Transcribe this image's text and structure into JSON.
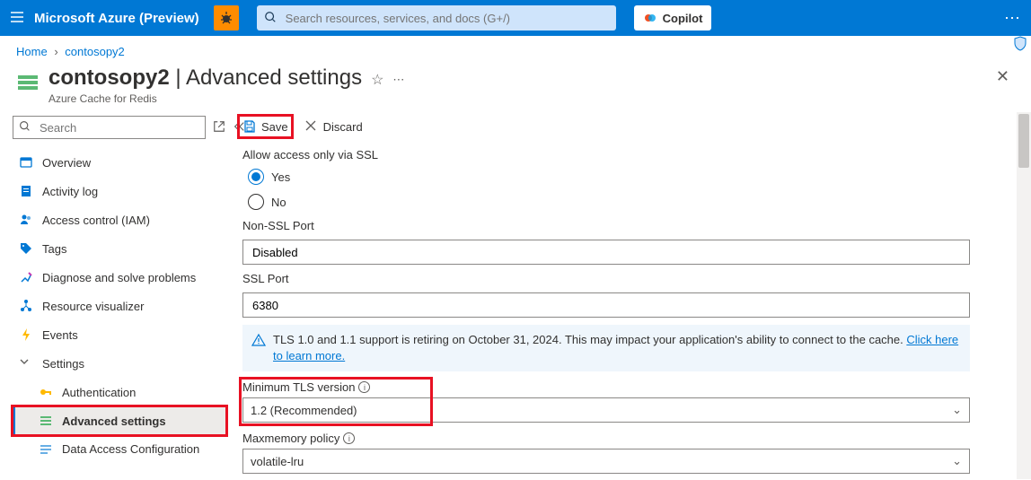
{
  "top": {
    "brand": "Microsoft Azure (Preview)",
    "search_placeholder": "Search resources, services, and docs (G+/)",
    "copilot": "Copilot"
  },
  "breadcrumb": {
    "home": "Home",
    "current": "contosopy2"
  },
  "header": {
    "resource": "contosopy2",
    "page": "Advanced settings",
    "subtype": "Azure Cache for Redis"
  },
  "sidebar": {
    "search_placeholder": "Search",
    "items": [
      {
        "label": "Overview"
      },
      {
        "label": "Activity log"
      },
      {
        "label": "Access control (IAM)"
      },
      {
        "label": "Tags"
      },
      {
        "label": "Diagnose and solve problems"
      },
      {
        "label": "Resource visualizer"
      },
      {
        "label": "Events"
      },
      {
        "label": "Settings",
        "group": true
      },
      {
        "label": "Authentication",
        "sub": true
      },
      {
        "label": "Advanced settings",
        "sub": true,
        "selected": true
      },
      {
        "label": "Data Access Configuration",
        "sub": true
      }
    ]
  },
  "toolbar": {
    "save": "Save",
    "discard": "Discard"
  },
  "form": {
    "allow_ssl_label": "Allow access only via SSL",
    "yes": "Yes",
    "no": "No",
    "non_ssl_port_label": "Non-SSL Port",
    "non_ssl_port_value": "Disabled",
    "ssl_port_label": "SSL Port",
    "ssl_port_value": "6380",
    "banner_text": "TLS 1.0 and 1.1 support is retiring on October 31, 2024. This may impact your application's ability to connect to the cache. ",
    "banner_link": "Click here to learn more.",
    "min_tls_label": "Minimum TLS version",
    "min_tls_value": "1.2 (Recommended)",
    "maxmem_label": "Maxmemory policy",
    "maxmem_value": "volatile-lru"
  }
}
